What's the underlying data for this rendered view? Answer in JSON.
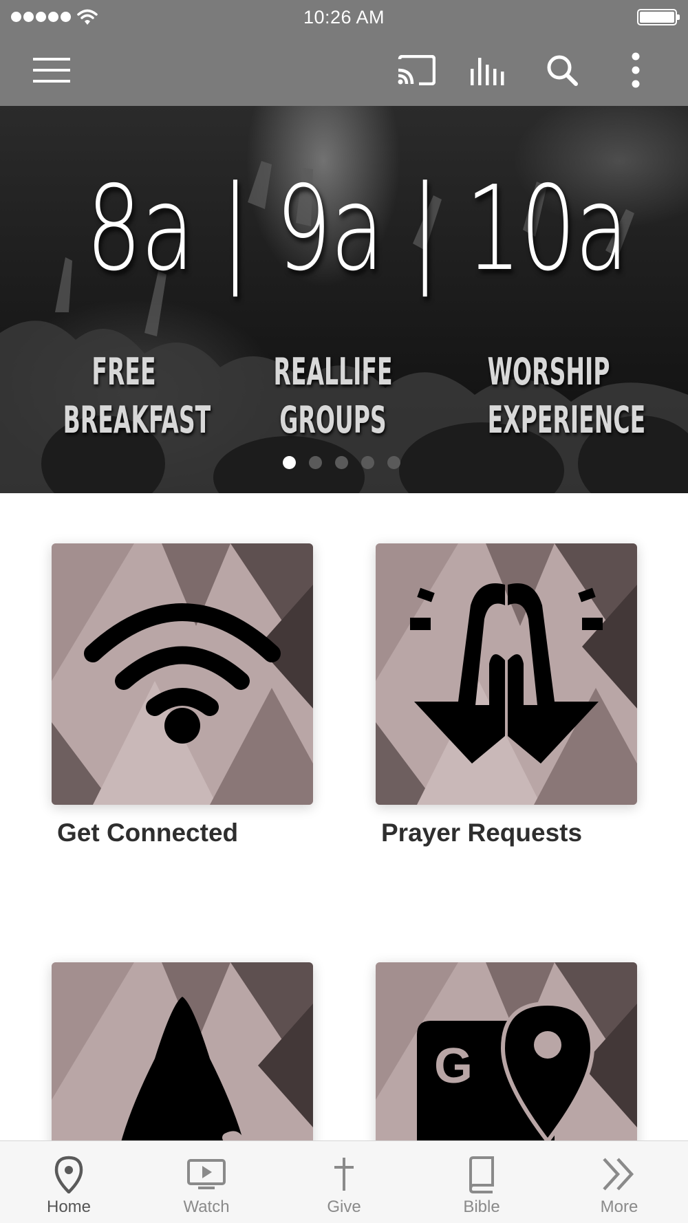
{
  "status_bar": {
    "time": "10:26 AM"
  },
  "hero": {
    "times": "8a | 9a | 10a",
    "labels": [
      {
        "line1": "FREE",
        "line2": "BREAKFAST"
      },
      {
        "line1": "REALLIFE",
        "line2": "GROUPS"
      },
      {
        "line1": "WORSHIP",
        "line2": "EXPERIENCE"
      }
    ],
    "slides_total": 5,
    "active_slide": 1
  },
  "tiles": [
    {
      "label": "Get Connected",
      "icon": "wifi-icon"
    },
    {
      "label": "Prayer Requests",
      "icon": "praying-hands-icon"
    },
    {
      "label": "",
      "icon": "water-drop-icon"
    },
    {
      "label": "",
      "icon": "google-maps-icon"
    }
  ],
  "tab_bar": [
    {
      "label": "Home",
      "icon": "map-pin-icon",
      "active": true
    },
    {
      "label": "Watch",
      "icon": "tv-play-icon",
      "active": false
    },
    {
      "label": "Give",
      "icon": "cross-icon",
      "active": false
    },
    {
      "label": "Bible",
      "icon": "book-icon",
      "active": false
    },
    {
      "label": "More",
      "icon": "double-chevron-icon",
      "active": false
    }
  ],
  "colors": {
    "header": "#7b7b7b",
    "tile_tint": "#b9a6a6",
    "tab_bar": "#f6f6f6",
    "tab_label": "#8a8a8a"
  }
}
